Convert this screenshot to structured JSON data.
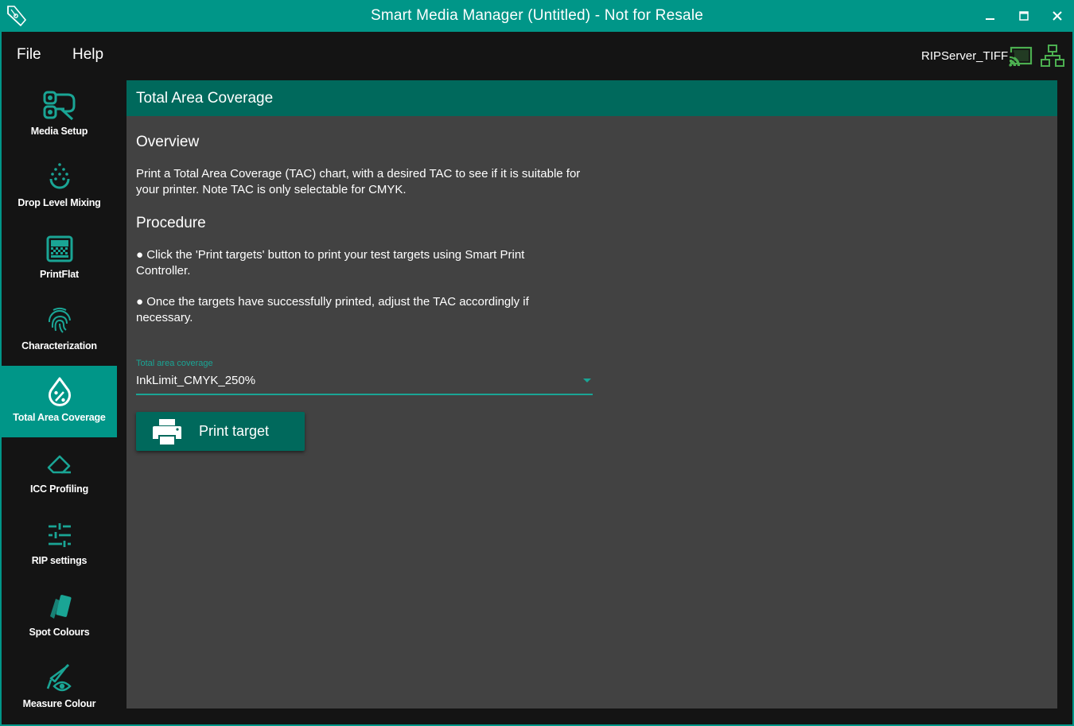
{
  "window": {
    "title": "Smart Media Manager (Untitled) - Not for Resale",
    "logo_icon": "pen-nib-logo-icon",
    "controls": [
      "minimize-icon",
      "maximize-icon",
      "close-icon"
    ]
  },
  "menu": {
    "file_label": "File",
    "help_label": "Help"
  },
  "server": {
    "name": "RIPServer_TIFF",
    "cast_icon": "cast-connected-icon",
    "network_icon": "network-icon",
    "status_color": "#4caf50"
  },
  "sidebar": {
    "items": [
      {
        "label": "Media Setup",
        "icon": "media-setup-icon"
      },
      {
        "label": "Drop Level Mixing",
        "icon": "drop-level-icon"
      },
      {
        "label": "PrintFlat",
        "icon": "printflat-icon"
      },
      {
        "label": "Characterization",
        "icon": "fingerprint-icon"
      },
      {
        "label": "Total Area Coverage",
        "icon": "ink-percent-icon",
        "active": true
      },
      {
        "label": "ICC Profiling",
        "icon": "eraser-icon"
      },
      {
        "label": "RIP settings",
        "icon": "sliders-icon"
      },
      {
        "label": "Spot Colours",
        "icon": "swatch-icon"
      },
      {
        "label": "Measure Colour",
        "icon": "measure-icon"
      }
    ]
  },
  "panel": {
    "header": "Total Area Coverage",
    "overview_title": "Overview",
    "overview_text": "Print a Total Area Coverage (TAC) chart, with a desired TAC to see if it is suitable for your printer. Note TAC is only selectable for CMYK.",
    "procedure_title": "Procedure",
    "step1": "● Click the 'Print targets' button to print your test targets using Smart Print Controller.",
    "step2": "● Once the targets have successfully printed, adjust the TAC accordingly if necessary.",
    "field_label": "Total area coverage",
    "field_value": "InkLimit_CMYK_250%",
    "print_button": "Print target",
    "print_icon": "printer-icon"
  },
  "colors": {
    "accent": "#009688",
    "accent_dark": "#00695c",
    "panel_bg": "#424242",
    "app_bg": "#141414"
  }
}
